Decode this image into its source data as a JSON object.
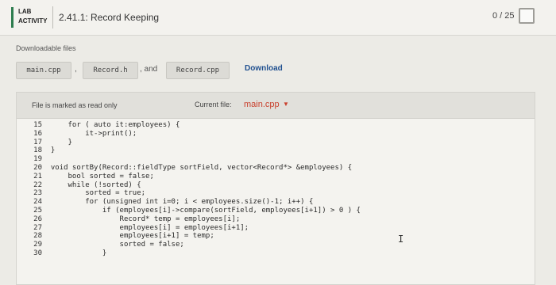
{
  "header": {
    "lab_line1": "LAB",
    "lab_line2": "ACTIVITY",
    "title": "2.41.1: Record Keeping",
    "score": "0 / 25"
  },
  "downloads": {
    "label": "Downloadable files",
    "files": [
      "main.cpp",
      "Record.h",
      "Record.cpp"
    ],
    "separator_comma": ",",
    "separator_and": ", and",
    "download_label": "Download"
  },
  "editor": {
    "readonly_note": "File is marked as read only",
    "current_file_label": "Current file:",
    "current_file": "main.cpp",
    "lines": [
      {
        "n": "15",
        "code": "    for ( auto it:employees) {"
      },
      {
        "n": "16",
        "code": "        it->print();"
      },
      {
        "n": "17",
        "code": "    }"
      },
      {
        "n": "18",
        "code": "}"
      },
      {
        "n": "19",
        "code": ""
      },
      {
        "n": "20",
        "code": "void sortBy(Record::fieldType sortField, vector<Record*> &employees) {"
      },
      {
        "n": "21",
        "code": "    bool sorted = false;"
      },
      {
        "n": "22",
        "code": "    while (!sorted) {"
      },
      {
        "n": "23",
        "code": "        sorted = true;"
      },
      {
        "n": "24",
        "code": "        for (unsigned int i=0; i < employees.size()-1; i++) {"
      },
      {
        "n": "25",
        "code": "            if (employees[i]->compare(sortField, employees[i+1]) > 0 ) {"
      },
      {
        "n": "26",
        "code": "                Record* temp = employees[i];"
      },
      {
        "n": "27",
        "code": "                employees[i] = employees[i+1];"
      },
      {
        "n": "28",
        "code": "                employees[i+1] = temp;"
      },
      {
        "n": "29",
        "code": "                sorted = false;"
      },
      {
        "n": "30",
        "code": "            }"
      }
    ]
  }
}
